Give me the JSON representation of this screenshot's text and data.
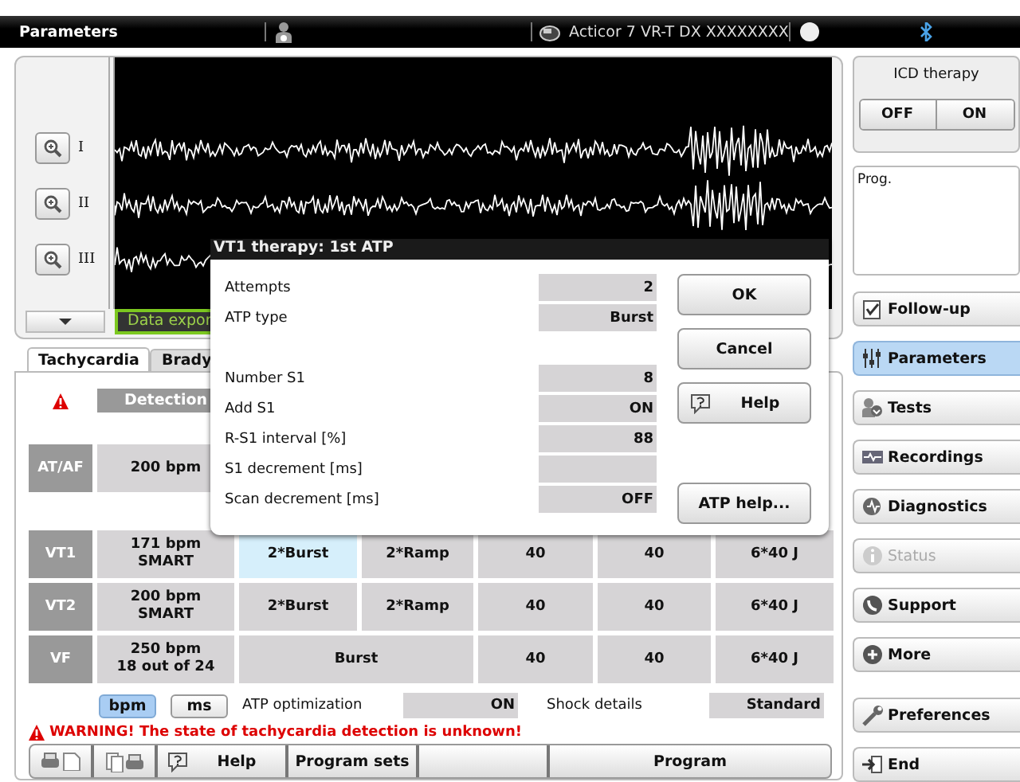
{
  "top_bar": {
    "title": "Parameters",
    "device": "Acticor 7 VR-T DX XXXXXXXX"
  },
  "ecg": {
    "leads": [
      "I",
      "II",
      "III"
    ],
    "export_label": "Data expor"
  },
  "tabs": [
    {
      "label": "Tachycardia",
      "selected": true
    },
    {
      "label": "Brady",
      "selected": false
    }
  ],
  "table": {
    "header": "Detection",
    "rows": [
      {
        "zone": "AT/AF",
        "detection": "200 bpm"
      },
      {
        "zone": "VT1",
        "detection": "171 bpm\nSMART",
        "cells": [
          {
            "text": "2*Burst",
            "kind": "single",
            "selected": true
          },
          {
            "text": "2*Ramp",
            "kind": "single",
            "selected": false
          },
          {
            "text": "40",
            "kind": "single",
            "selected": false
          },
          {
            "text": "40",
            "kind": "single",
            "selected": false
          },
          {
            "text": "6*40 J",
            "kind": "single",
            "selected": false
          }
        ]
      },
      {
        "zone": "VT2",
        "detection": "200 bpm\nSMART",
        "cells": [
          {
            "text": "2*Burst",
            "kind": "single",
            "selected": false
          },
          {
            "text": "2*Ramp",
            "kind": "single",
            "selected": false
          },
          {
            "text": "40",
            "kind": "single",
            "selected": false
          },
          {
            "text": "40",
            "kind": "single",
            "selected": false
          },
          {
            "text": "6*40 J",
            "kind": "single",
            "selected": false
          }
        ]
      },
      {
        "zone": "VF",
        "detection": "250 bpm\n18 out of 24",
        "cells": [
          {
            "text": "Burst",
            "kind": "wide",
            "selected": false
          },
          {
            "text": "40",
            "kind": "single",
            "selected": false
          },
          {
            "text": "40",
            "kind": "single",
            "selected": false
          },
          {
            "text": "6*40 J",
            "kind": "single",
            "selected": false
          }
        ]
      }
    ]
  },
  "units": [
    {
      "label": "bpm",
      "selected": true
    },
    {
      "label": "ms",
      "selected": false
    }
  ],
  "atp_optimization": {
    "label": "ATP optimization",
    "value": "ON"
  },
  "shock_details": {
    "label": "Shock details",
    "value": "Standard"
  },
  "warning": "WARNING! The state of tachycardia detection is unknown!",
  "toolbar": [
    {
      "kind": "print"
    },
    {
      "kind": "copy"
    },
    {
      "kind": "help",
      "label": "Help"
    },
    {
      "kind": "text",
      "label": "Program sets"
    },
    {
      "kind": "blank"
    },
    {
      "kind": "text",
      "label": "Program"
    }
  ],
  "sidebar": {
    "icd_title": "ICD therapy",
    "icd_buttons": [
      "OFF",
      "ON"
    ],
    "note": "Prog.",
    "nav": [
      {
        "label": "Follow-up",
        "kind": "followup",
        "selected": false,
        "disabled": false
      },
      {
        "label": "Parameters",
        "kind": "parameters",
        "selected": true,
        "disabled": false
      },
      {
        "label": "Tests",
        "kind": "tests",
        "selected": false,
        "disabled": false
      },
      {
        "label": "Recordings",
        "kind": "recordings",
        "selected": false,
        "disabled": false
      },
      {
        "label": "Diagnostics",
        "kind": "diagnostics",
        "selected": false,
        "disabled": false
      },
      {
        "label": "Status",
        "kind": "status",
        "selected": false,
        "disabled": true
      },
      {
        "label": "Support",
        "kind": "support",
        "selected": false,
        "disabled": false
      },
      {
        "label": "More",
        "kind": "more",
        "selected": false,
        "disabled": false
      }
    ],
    "nav_bottom": [
      {
        "label": "Preferences",
        "kind": "preferences",
        "selected": false,
        "disabled": false
      },
      {
        "label": "End",
        "kind": "end",
        "selected": false,
        "disabled": false
      }
    ]
  },
  "dialog": {
    "title": "VT1 therapy: 1st ATP",
    "groups": [
      [
        {
          "label": "Attempts",
          "value": "2"
        },
        {
          "label": "ATP type",
          "value": "Burst"
        }
      ],
      [
        {
          "label": "Number S1",
          "value": "8"
        },
        {
          "label": "Add S1",
          "value": "ON"
        },
        {
          "label": "R-S1 interval [%]",
          "value": "88"
        },
        {
          "label": "S1 decrement [ms]"
        },
        {
          "label": "Scan decrement [ms]",
          "value": "OFF"
        }
      ]
    ],
    "buttons": [
      {
        "label": "OK",
        "kind": "plain"
      },
      {
        "label": "Cancel",
        "kind": "plain"
      },
      {
        "label": "Help",
        "kind": "help"
      }
    ],
    "extra_button": "ATP help..."
  }
}
